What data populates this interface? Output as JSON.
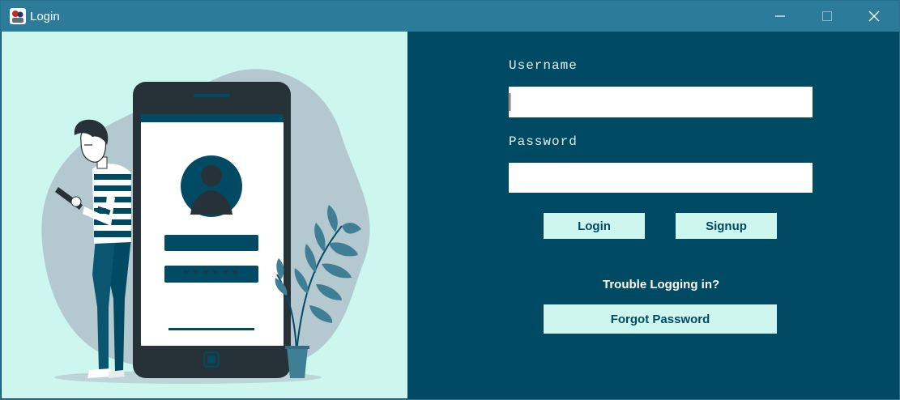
{
  "window": {
    "title": "Login",
    "controls": [
      "minimize",
      "maximize",
      "close"
    ]
  },
  "form": {
    "username_label": "Username",
    "username_value": "",
    "password_label": "Password",
    "password_value": "",
    "login_label": "Login",
    "signup_label": "Signup",
    "trouble_text": "Trouble Logging in?",
    "forgot_label": "Forgot Password"
  },
  "illustration": {
    "masked_password": "******",
    "icons": [
      "user-avatar-icon",
      "person-figure",
      "smartphone",
      "plant-icon"
    ]
  },
  "colors": {
    "titlebar": "#2d7b9b",
    "panel_dark": "#004a63",
    "panel_light": "#cdf6ee",
    "blob": "#b4c8cf",
    "phone": "#263238",
    "text_light": "#e9f3f6"
  }
}
